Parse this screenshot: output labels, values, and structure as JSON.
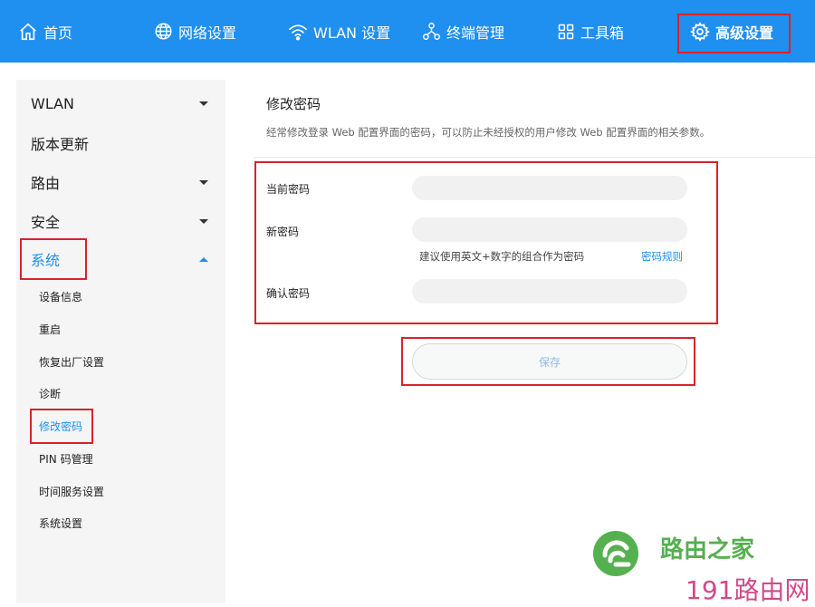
{
  "nav": {
    "items": [
      {
        "label": "首页",
        "icon": "home-icon"
      },
      {
        "label": "网络设置",
        "icon": "globe-icon"
      },
      {
        "label": "WLAN 设置",
        "icon": "wifi-icon"
      },
      {
        "label": "终端管理",
        "icon": "devices-icon"
      },
      {
        "label": "工具箱",
        "icon": "grid-icon"
      },
      {
        "label": "高级设置",
        "icon": "gear-icon",
        "active": true
      }
    ]
  },
  "sidebar": {
    "items": [
      {
        "label": "WLAN",
        "expandable": true
      },
      {
        "label": "版本更新",
        "expandable": false
      },
      {
        "label": "路由",
        "expandable": true
      },
      {
        "label": "安全",
        "expandable": true
      },
      {
        "label": "系统",
        "expandable": true,
        "expanded": true,
        "active": true
      }
    ],
    "sub_items": [
      {
        "label": "设备信息"
      },
      {
        "label": "重启"
      },
      {
        "label": "恢复出厂设置"
      },
      {
        "label": "诊断"
      },
      {
        "label": "修改密码",
        "active": true
      },
      {
        "label": "PIN 码管理"
      },
      {
        "label": "时间服务设置"
      },
      {
        "label": "系统设置"
      }
    ]
  },
  "main": {
    "title": "修改密码",
    "description": "经常修改登录 Web 配置界面的密码，可以防止未经授权的用户修改 Web 配置界面的相关参数。",
    "fields": {
      "current_password": {
        "label": "当前密码",
        "value": ""
      },
      "new_password": {
        "label": "新密码",
        "value": ""
      },
      "confirm_password": {
        "label": "确认密码",
        "value": ""
      }
    },
    "hint": "建议使用英文+数字的组合作为密码",
    "rule_link": "密码规则",
    "save_label": "保存"
  },
  "watermark": {
    "text1": "路由之家",
    "text2": "191路由网"
  },
  "colors": {
    "brand_blue": "#1f8ff0",
    "highlight_red": "#d8232a",
    "watermark_green": "#55b04f",
    "watermark_pink": "#d04a8a"
  }
}
